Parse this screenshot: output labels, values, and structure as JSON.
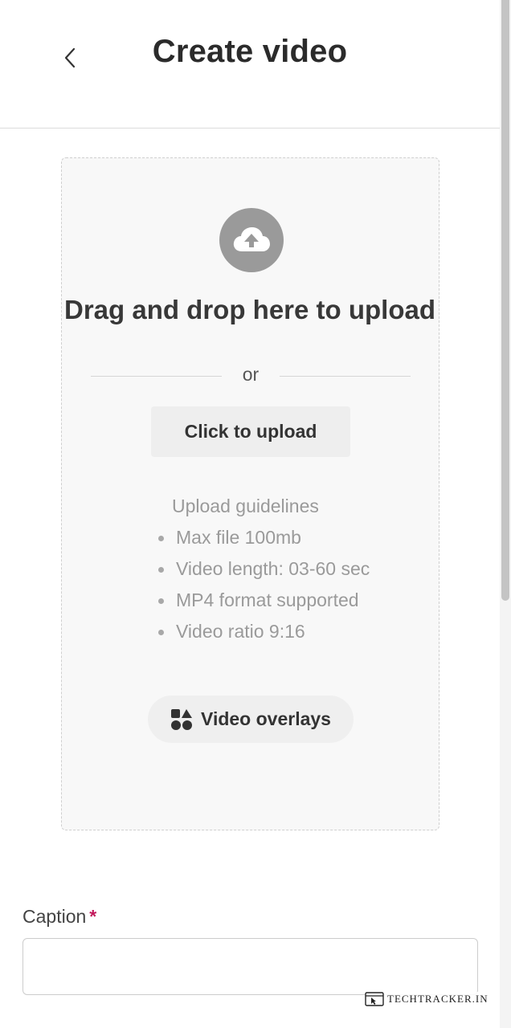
{
  "header": {
    "title": "Create video",
    "back_icon": "chevron-left-icon"
  },
  "upload": {
    "icon": "cloud-upload-icon",
    "drag_text": "Drag and drop here to upload",
    "or_text": "or",
    "button_label": "Click to upload",
    "guidelines_title": "Upload guidelines",
    "guidelines": [
      "Max file 100mb",
      "Video length: 03-60 sec",
      "MP4 format supported",
      "Video ratio 9:16"
    ]
  },
  "overlays": {
    "icon": "shapes-icon",
    "label": "Video overlays"
  },
  "caption": {
    "label": "Caption",
    "required_marker": "*",
    "value": "",
    "required_color": "#c2185b"
  },
  "watermark": {
    "text": "TECHTRACKER.IN"
  }
}
